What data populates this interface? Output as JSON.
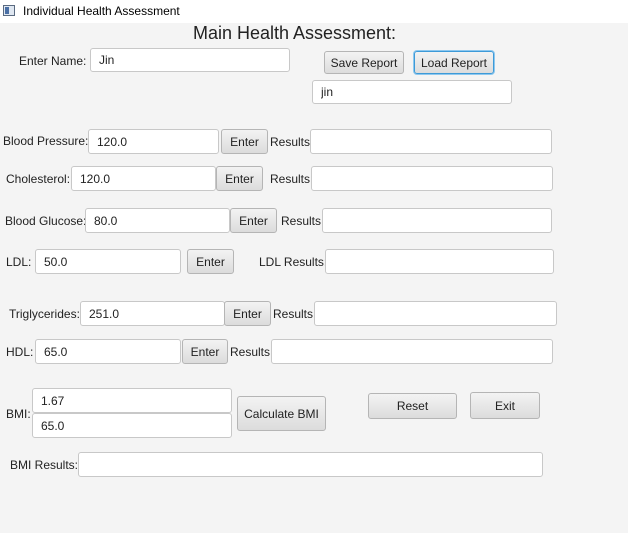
{
  "window": {
    "title": "Individual Health Assessment"
  },
  "heading": "Main Health Assessment:",
  "name": {
    "label": "Enter Name:",
    "value": "Jin"
  },
  "report": {
    "save_label": "Save Report",
    "load_label": "Load Report",
    "file_value": "jin"
  },
  "blood_pressure": {
    "label": "Blood Pressure:",
    "value": "120.0",
    "button": "Enter",
    "results_label": "Results:",
    "results_value": ""
  },
  "cholesterol": {
    "label": "Cholesterol:",
    "value": "120.0",
    "button": "Enter",
    "results_label": "Results:",
    "results_value": ""
  },
  "blood_glucose": {
    "label": "Blood Glucose:",
    "value": "80.0",
    "button": "Enter",
    "results_label": "Results:",
    "results_value": ""
  },
  "ldl": {
    "label": "LDL:",
    "value": "50.0",
    "button": "Enter",
    "results_label": "LDL Results:",
    "results_value": ""
  },
  "triglycerides": {
    "label": "Triglycerides:",
    "value": "251.0",
    "button": "Enter",
    "results_label": "Results:",
    "results_value": ""
  },
  "hdl": {
    "label": "HDL:",
    "value": "65.0",
    "button": "Enter",
    "results_label": "Results:",
    "results_value": ""
  },
  "bmi": {
    "label": "BMI:",
    "height_value": "1.67",
    "weight_value": "65.0",
    "button": "Calculate BMI",
    "results_label": "BMI Results:",
    "results_value": ""
  },
  "actions": {
    "reset_label": "Reset",
    "exit_label": "Exit"
  }
}
